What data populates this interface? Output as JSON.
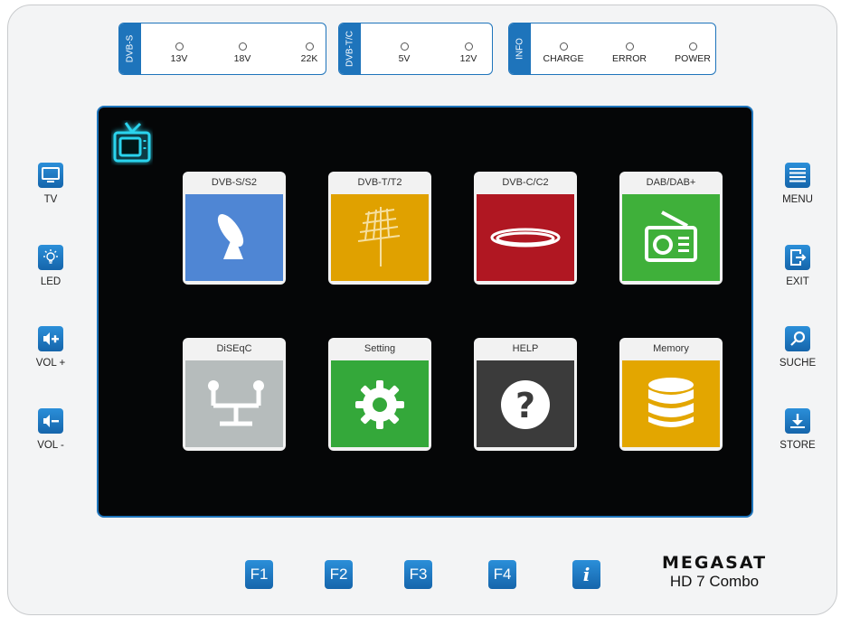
{
  "indicators": {
    "dvbs": {
      "tag": "DVB-S",
      "leds": [
        "13V",
        "18V",
        "22K"
      ]
    },
    "dvbtc": {
      "tag": "DVB-T/C",
      "leds": [
        "5V",
        "12V"
      ]
    },
    "info": {
      "tag": "INFO",
      "leds": [
        "CHARGE",
        "ERROR",
        "POWER"
      ]
    }
  },
  "left_buttons": [
    {
      "label": "TV",
      "icon": "monitor-icon"
    },
    {
      "label": "LED",
      "icon": "light-bulb-icon"
    },
    {
      "label": "VOL +",
      "icon": "volume-up-icon"
    },
    {
      "label": "VOL -",
      "icon": "volume-down-icon"
    }
  ],
  "right_buttons": [
    {
      "label": "MENU",
      "icon": "menu-icon"
    },
    {
      "label": "EXIT",
      "icon": "exit-icon"
    },
    {
      "label": "SUCHE",
      "icon": "search-icon"
    },
    {
      "label": "STORE",
      "icon": "download-icon"
    }
  ],
  "tiles": [
    {
      "label": "DVB-S/S2",
      "icon": "satellite-dish-icon",
      "color": "#4f86d4"
    },
    {
      "label": "DVB-T/T2",
      "icon": "antenna-icon",
      "color": "#e0a100"
    },
    {
      "label": "DVB-C/C2",
      "icon": "cable-icon",
      "color": "#b01722"
    },
    {
      "label": "DAB/DAB+",
      "icon": "radio-icon",
      "color": "#3fb03a"
    },
    {
      "label": "DiSEqC",
      "icon": "diseqc-switch-icon",
      "color": "#b6bcbc"
    },
    {
      "label": "Setting",
      "icon": "gear-icon",
      "color": "#34a83a"
    },
    {
      "label": "HELP",
      "icon": "question-icon",
      "color": "#3b3b3b"
    },
    {
      "label": "Memory",
      "icon": "database-icon",
      "color": "#e3a600"
    }
  ],
  "function_keys": [
    "F1",
    "F2",
    "F3",
    "F4",
    "i"
  ],
  "brand": {
    "logo": "MEGASAT",
    "model": "HD 7 Combo"
  },
  "colors": {
    "accent": "#1e74bb",
    "tv_glow": "#2ad4ee"
  }
}
